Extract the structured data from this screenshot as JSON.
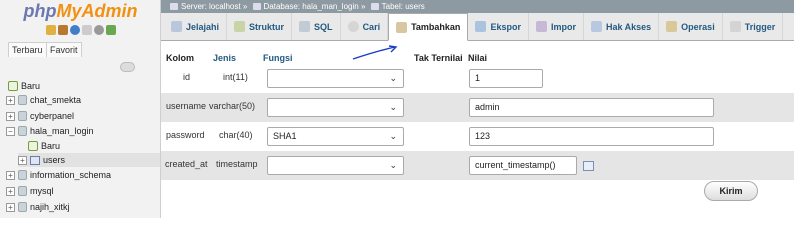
{
  "sidebar": {
    "logo_php": "php",
    "logo_myadmin": "MyAdmin",
    "tabs": [
      "Terbaru",
      "Favorit"
    ],
    "items": [
      {
        "label": "Baru"
      },
      {
        "label": "chat_smekta"
      },
      {
        "label": "cyberpanel"
      },
      {
        "label": "hala_man_login"
      },
      {
        "label": "Baru"
      },
      {
        "label": "users"
      },
      {
        "label": "information_schema"
      },
      {
        "label": "mysql"
      },
      {
        "label": "najih_xitkj"
      }
    ]
  },
  "breadcrumb": {
    "server": "Server: localhost",
    "database": "Database: hala_man_login",
    "table": "Tabel: users",
    "sep": "»"
  },
  "tabs": [
    "Jelajahi",
    "Struktur",
    "SQL",
    "Cari",
    "Tambahkan",
    "Ekspor",
    "Impor",
    "Hak Akses",
    "Operasi",
    "Trigger"
  ],
  "active_tab": "Tambahkan",
  "form": {
    "headers": {
      "kolom": "Kolom",
      "jenis": "Jenis",
      "fungsi": "Fungsi",
      "tak_ternilai": "Tak Ternilai",
      "nilai": "Nilai"
    },
    "rows": [
      {
        "kolom": "id",
        "jenis": "int(11)",
        "fungsi": "",
        "nilai": "1"
      },
      {
        "kolom": "username",
        "jenis": "varchar(50)",
        "fungsi": "",
        "nilai": "admin"
      },
      {
        "kolom": "password",
        "jenis": "char(40)",
        "fungsi": "SHA1",
        "nilai": "123"
      },
      {
        "kolom": "created_at",
        "jenis": "timestamp",
        "fungsi": "",
        "nilai": "current_timestamp()"
      }
    ],
    "submit_label": "Kirim"
  },
  "icons": {
    "chevron": "chevron-down-icon",
    "calendar": "calendar-icon"
  },
  "colors": {
    "link": "#235a81",
    "logo_php": "#6c78af",
    "logo_myadmin": "#f29111",
    "topbar": "#8e9aa1",
    "alt_row": "#e5e5e5"
  }
}
